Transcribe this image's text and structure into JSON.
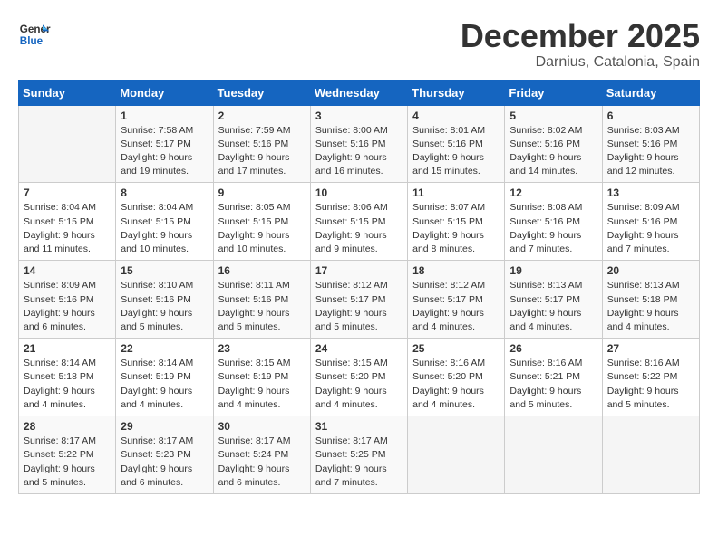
{
  "logo": {
    "line1": "General",
    "line2": "Blue"
  },
  "title": "December 2025",
  "location": "Darnius, Catalonia, Spain",
  "weekdays": [
    "Sunday",
    "Monday",
    "Tuesday",
    "Wednesday",
    "Thursday",
    "Friday",
    "Saturday"
  ],
  "weeks": [
    [
      {
        "day": "",
        "sunrise": "",
        "sunset": "",
        "daylight": "",
        "empty": true
      },
      {
        "day": "1",
        "sunrise": "Sunrise: 7:58 AM",
        "sunset": "Sunset: 5:17 PM",
        "daylight": "Daylight: 9 hours and 19 minutes."
      },
      {
        "day": "2",
        "sunrise": "Sunrise: 7:59 AM",
        "sunset": "Sunset: 5:16 PM",
        "daylight": "Daylight: 9 hours and 17 minutes."
      },
      {
        "day": "3",
        "sunrise": "Sunrise: 8:00 AM",
        "sunset": "Sunset: 5:16 PM",
        "daylight": "Daylight: 9 hours and 16 minutes."
      },
      {
        "day": "4",
        "sunrise": "Sunrise: 8:01 AM",
        "sunset": "Sunset: 5:16 PM",
        "daylight": "Daylight: 9 hours and 15 minutes."
      },
      {
        "day": "5",
        "sunrise": "Sunrise: 8:02 AM",
        "sunset": "Sunset: 5:16 PM",
        "daylight": "Daylight: 9 hours and 14 minutes."
      },
      {
        "day": "6",
        "sunrise": "Sunrise: 8:03 AM",
        "sunset": "Sunset: 5:16 PM",
        "daylight": "Daylight: 9 hours and 12 minutes."
      }
    ],
    [
      {
        "day": "7",
        "sunrise": "Sunrise: 8:04 AM",
        "sunset": "Sunset: 5:15 PM",
        "daylight": "Daylight: 9 hours and 11 minutes."
      },
      {
        "day": "8",
        "sunrise": "Sunrise: 8:04 AM",
        "sunset": "Sunset: 5:15 PM",
        "daylight": "Daylight: 9 hours and 10 minutes."
      },
      {
        "day": "9",
        "sunrise": "Sunrise: 8:05 AM",
        "sunset": "Sunset: 5:15 PM",
        "daylight": "Daylight: 9 hours and 10 minutes."
      },
      {
        "day": "10",
        "sunrise": "Sunrise: 8:06 AM",
        "sunset": "Sunset: 5:15 PM",
        "daylight": "Daylight: 9 hours and 9 minutes."
      },
      {
        "day": "11",
        "sunrise": "Sunrise: 8:07 AM",
        "sunset": "Sunset: 5:15 PM",
        "daylight": "Daylight: 9 hours and 8 minutes."
      },
      {
        "day": "12",
        "sunrise": "Sunrise: 8:08 AM",
        "sunset": "Sunset: 5:16 PM",
        "daylight": "Daylight: 9 hours and 7 minutes."
      },
      {
        "day": "13",
        "sunrise": "Sunrise: 8:09 AM",
        "sunset": "Sunset: 5:16 PM",
        "daylight": "Daylight: 9 hours and 7 minutes."
      }
    ],
    [
      {
        "day": "14",
        "sunrise": "Sunrise: 8:09 AM",
        "sunset": "Sunset: 5:16 PM",
        "daylight": "Daylight: 9 hours and 6 minutes."
      },
      {
        "day": "15",
        "sunrise": "Sunrise: 8:10 AM",
        "sunset": "Sunset: 5:16 PM",
        "daylight": "Daylight: 9 hours and 5 minutes."
      },
      {
        "day": "16",
        "sunrise": "Sunrise: 8:11 AM",
        "sunset": "Sunset: 5:16 PM",
        "daylight": "Daylight: 9 hours and 5 minutes."
      },
      {
        "day": "17",
        "sunrise": "Sunrise: 8:12 AM",
        "sunset": "Sunset: 5:17 PM",
        "daylight": "Daylight: 9 hours and 5 minutes."
      },
      {
        "day": "18",
        "sunrise": "Sunrise: 8:12 AM",
        "sunset": "Sunset: 5:17 PM",
        "daylight": "Daylight: 9 hours and 4 minutes."
      },
      {
        "day": "19",
        "sunrise": "Sunrise: 8:13 AM",
        "sunset": "Sunset: 5:17 PM",
        "daylight": "Daylight: 9 hours and 4 minutes."
      },
      {
        "day": "20",
        "sunrise": "Sunrise: 8:13 AM",
        "sunset": "Sunset: 5:18 PM",
        "daylight": "Daylight: 9 hours and 4 minutes."
      }
    ],
    [
      {
        "day": "21",
        "sunrise": "Sunrise: 8:14 AM",
        "sunset": "Sunset: 5:18 PM",
        "daylight": "Daylight: 9 hours and 4 minutes."
      },
      {
        "day": "22",
        "sunrise": "Sunrise: 8:14 AM",
        "sunset": "Sunset: 5:19 PM",
        "daylight": "Daylight: 9 hours and 4 minutes."
      },
      {
        "day": "23",
        "sunrise": "Sunrise: 8:15 AM",
        "sunset": "Sunset: 5:19 PM",
        "daylight": "Daylight: 9 hours and 4 minutes."
      },
      {
        "day": "24",
        "sunrise": "Sunrise: 8:15 AM",
        "sunset": "Sunset: 5:20 PM",
        "daylight": "Daylight: 9 hours and 4 minutes."
      },
      {
        "day": "25",
        "sunrise": "Sunrise: 8:16 AM",
        "sunset": "Sunset: 5:20 PM",
        "daylight": "Daylight: 9 hours and 4 minutes."
      },
      {
        "day": "26",
        "sunrise": "Sunrise: 8:16 AM",
        "sunset": "Sunset: 5:21 PM",
        "daylight": "Daylight: 9 hours and 5 minutes."
      },
      {
        "day": "27",
        "sunrise": "Sunrise: 8:16 AM",
        "sunset": "Sunset: 5:22 PM",
        "daylight": "Daylight: 9 hours and 5 minutes."
      }
    ],
    [
      {
        "day": "28",
        "sunrise": "Sunrise: 8:17 AM",
        "sunset": "Sunset: 5:22 PM",
        "daylight": "Daylight: 9 hours and 5 minutes."
      },
      {
        "day": "29",
        "sunrise": "Sunrise: 8:17 AM",
        "sunset": "Sunset: 5:23 PM",
        "daylight": "Daylight: 9 hours and 6 minutes."
      },
      {
        "day": "30",
        "sunrise": "Sunrise: 8:17 AM",
        "sunset": "Sunset: 5:24 PM",
        "daylight": "Daylight: 9 hours and 6 minutes."
      },
      {
        "day": "31",
        "sunrise": "Sunrise: 8:17 AM",
        "sunset": "Sunset: 5:25 PM",
        "daylight": "Daylight: 9 hours and 7 minutes."
      },
      {
        "day": "",
        "sunrise": "",
        "sunset": "",
        "daylight": "",
        "empty": true
      },
      {
        "day": "",
        "sunrise": "",
        "sunset": "",
        "daylight": "",
        "empty": true
      },
      {
        "day": "",
        "sunrise": "",
        "sunset": "",
        "daylight": "",
        "empty": true
      }
    ]
  ]
}
